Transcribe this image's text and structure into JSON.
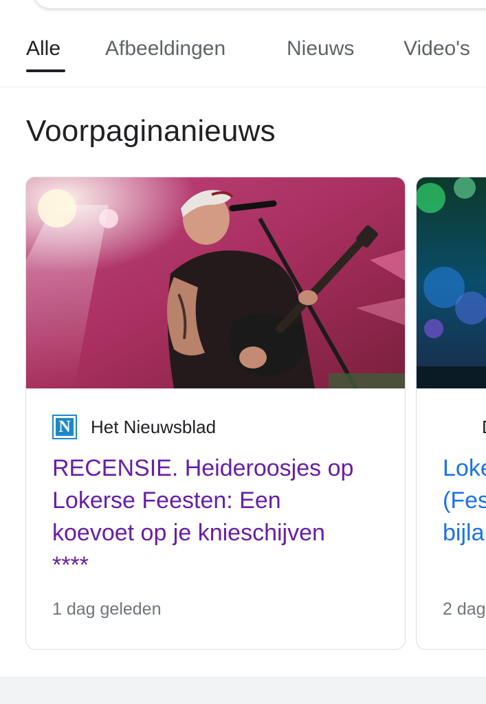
{
  "tabs": [
    {
      "label": "Alle",
      "active": true
    },
    {
      "label": "Afbeeldingen",
      "active": false
    },
    {
      "label": "Nieuws",
      "active": false
    },
    {
      "label": "Video's",
      "active": false
    }
  ],
  "section": {
    "title": "Voorpaginanieuws"
  },
  "cards": [
    {
      "source_logo_letter": "N",
      "source": "Het Nieuwsblad",
      "headline_lines": [
        "RECENSIE. Heideroosjes op",
        "Lokerse Feesten: Een",
        "koevoet op je knieschijven",
        "****"
      ],
      "time": "1 dag geleden"
    },
    {
      "source": "D",
      "headline_lines": [
        "Loke",
        "(Fes",
        "bijla"
      ],
      "time": "2 dag"
    }
  ],
  "colors": {
    "visited_link": "#681da8",
    "link": "#1a73e8",
    "source_logo": "#1e88c7"
  }
}
